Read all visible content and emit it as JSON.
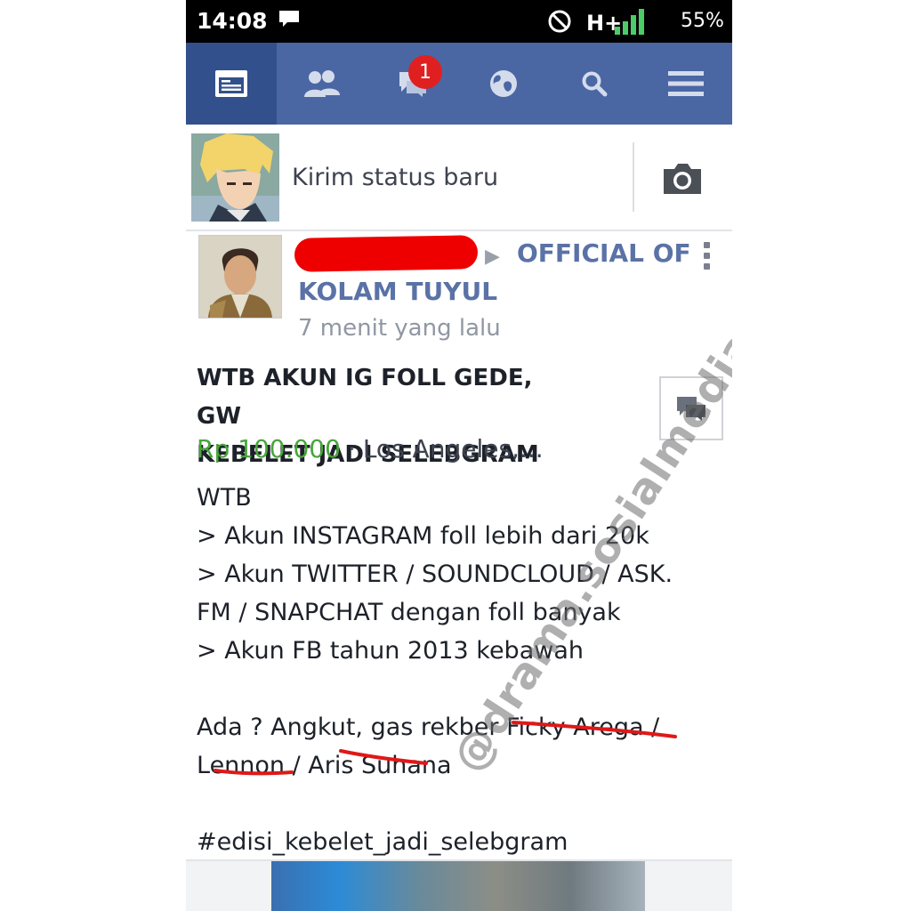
{
  "status_bar": {
    "time": "14:08",
    "network": "H+",
    "battery": "55%"
  },
  "nav": {
    "tabs": [
      {
        "icon": "news-feed-icon",
        "active": true
      },
      {
        "icon": "friends-icon"
      },
      {
        "icon": "messages-icon",
        "badge": "1"
      },
      {
        "icon": "globe-icon"
      },
      {
        "icon": "search-icon"
      },
      {
        "icon": "menu-icon"
      }
    ]
  },
  "composer": {
    "placeholder": "Kirim status baru"
  },
  "post": {
    "group_line1": "OFFICIAL OF",
    "group_line2": "KOLAM TUYUL",
    "time": "7 menit yang lalu",
    "title_line1": "WTB AKUN IG FOLL GEDE, GW",
    "title_line2": "KEBELET JADI SELEBGRAM",
    "price": "Rp 100.000",
    "separator": "·",
    "location": "Los Angeles,...",
    "body": {
      "line1": "WTB",
      "line2": "> Akun INSTAGRAM foll lebih dari 20k",
      "line3": "> Akun TWITTER / SOUNDCLOUD / ASK.",
      "line4": "FM / SNAPCHAT dengan foll banyak",
      "line5": "> Akun FB tahun 2013 kebawah",
      "line6": "Ada ? Angkut, gas rekber Ficky Arega /",
      "line7": "Lennon / Aris Suhana",
      "hashtag": "#edisi_kebelet_jadi_selebgram"
    }
  },
  "watermark": "@drama.sosialmedia",
  "colors": {
    "nav_bg": "#4a67a4",
    "nav_active": "#32508b",
    "link": "#5a72a6",
    "price": "#4aa43c",
    "badge": "#e02020",
    "redact": "#ef0000"
  }
}
